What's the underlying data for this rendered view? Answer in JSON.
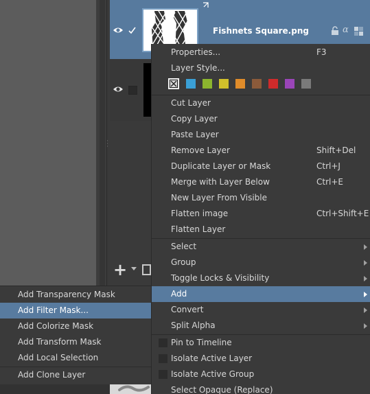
{
  "layers": {
    "selected_name": "Fishnets Square.png"
  },
  "context_menu": {
    "top_items": [
      {
        "label": "Properties...",
        "shortcut": "F3"
      },
      {
        "label": "Layer Style...",
        "shortcut": ""
      }
    ],
    "color_labels": [
      "#3a9fd5",
      "#8cb52e",
      "#d1c02b",
      "#e08c2a",
      "#8b5a3a",
      "#cf2b2b",
      "#9a45b8",
      "#7a7a7a"
    ],
    "edit_items": [
      {
        "label": "Cut Layer",
        "shortcut": ""
      },
      {
        "label": "Copy Layer",
        "shortcut": ""
      },
      {
        "label": "Paste Layer",
        "shortcut": ""
      },
      {
        "label": "Remove Layer",
        "shortcut": "Shift+Del"
      },
      {
        "label": "Duplicate Layer or Mask",
        "shortcut": "Ctrl+J"
      },
      {
        "label": "Merge with Layer Below",
        "shortcut": "Ctrl+E"
      },
      {
        "label": "New Layer From Visible",
        "shortcut": ""
      },
      {
        "label": "Flatten image",
        "shortcut": "Ctrl+Shift+E"
      },
      {
        "label": "Flatten Layer",
        "shortcut": ""
      }
    ],
    "submenu_items": [
      {
        "label": "Select"
      },
      {
        "label": "Group"
      },
      {
        "label": "Toggle Locks & Visibility"
      },
      {
        "label": "Add"
      },
      {
        "label": "Convert"
      },
      {
        "label": "Split Alpha"
      }
    ],
    "check_items": [
      {
        "label": "Pin to Timeline"
      },
      {
        "label": "Isolate Active Layer"
      },
      {
        "label": "Isolate Active Group"
      },
      {
        "label": "Select Opaque (Replace)"
      }
    ]
  },
  "add_submenu": {
    "items": [
      {
        "label": "Add Transparency Mask"
      },
      {
        "label": "Add Filter Mask..."
      },
      {
        "label": "Add Colorize Mask"
      },
      {
        "label": "Add Transform Mask"
      },
      {
        "label": "Add Local Selection"
      },
      {
        "label": "Add Clone Layer"
      }
    ]
  }
}
